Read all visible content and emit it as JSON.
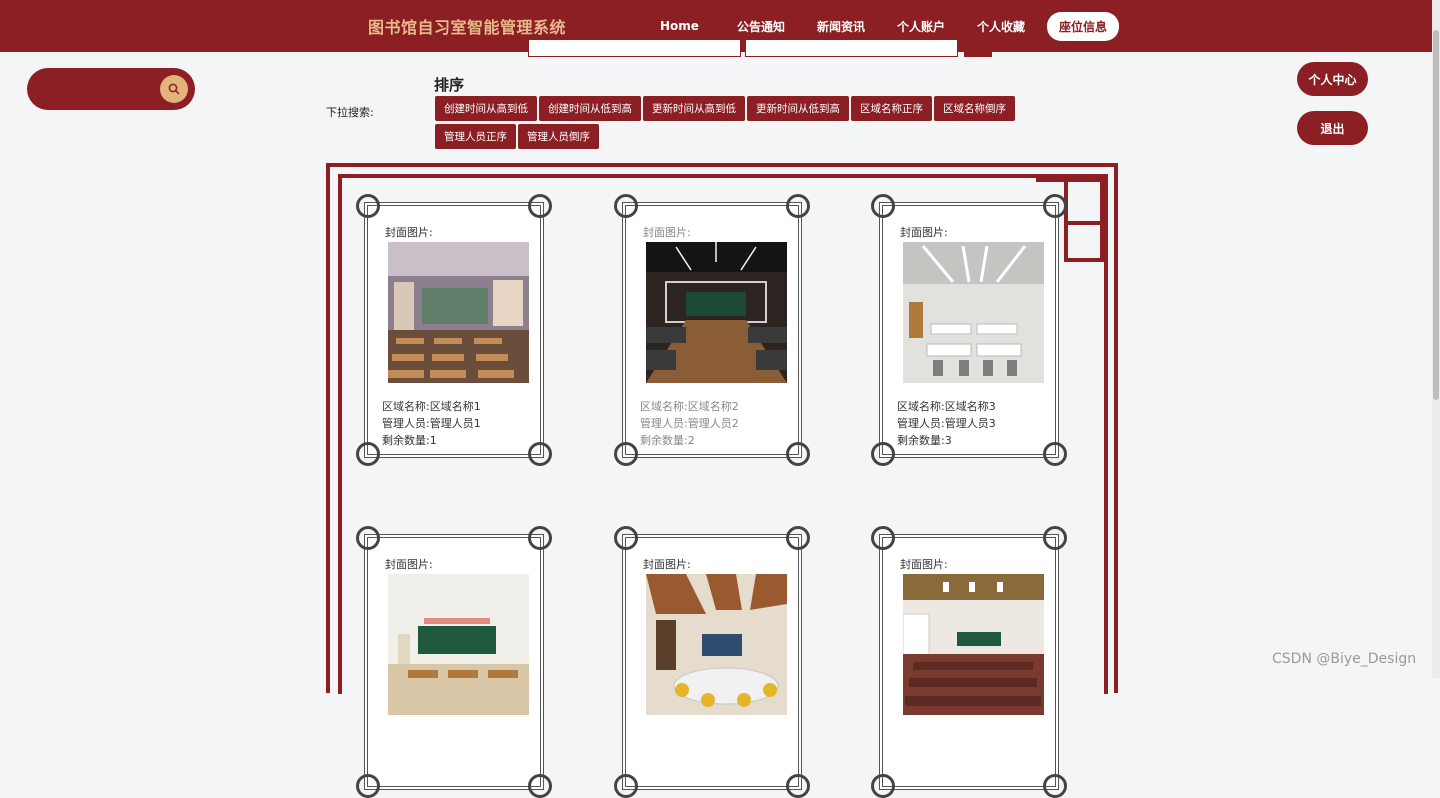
{
  "header": {
    "site_title": "图书馆自习室智能管理系统",
    "nav": [
      "Home",
      "公告通知",
      "新闻资讯",
      "个人账户",
      "个人收藏",
      "座位信息"
    ],
    "active_index": 5
  },
  "side_search": {
    "placeholder": ""
  },
  "right_actions": {
    "personal_center": "个人中心",
    "logout": "退出"
  },
  "sort": {
    "dropdown_label": "下拉搜索:",
    "title": "排序",
    "buttons": [
      "创建时间从高到低",
      "创建时间从低到高",
      "更新时间从高到低",
      "更新时间从低到高",
      "区域名称正序",
      "区域名称倒序",
      "管理人员正序",
      "管理人员倒序"
    ]
  },
  "cards": [
    {
      "cover_label": "封面图片:",
      "area": "区域名称:区域名称1",
      "manager": "管理人员:管理人员1",
      "remaining": "剩余数量:1",
      "image": "classroom-sunset"
    },
    {
      "cover_label": "封面图片:",
      "area": "区域名称:区域名称2",
      "manager": "管理人员:管理人员2",
      "remaining": "剩余数量:2",
      "image": "computer-lab"
    },
    {
      "cover_label": "封面图片:",
      "area": "区域名称:区域名称3",
      "manager": "管理人员:管理人员3",
      "remaining": "剩余数量:3",
      "image": "bright-classroom"
    },
    {
      "cover_label": "封面图片:",
      "area": "",
      "manager": "",
      "remaining": "",
      "image": "classroom-green-board"
    },
    {
      "cover_label": "封面图片:",
      "area": "",
      "manager": "",
      "remaining": "",
      "image": "wood-ceiling-room"
    },
    {
      "cover_label": "封面图片:",
      "area": "",
      "manager": "",
      "remaining": "",
      "image": "lecture-hall"
    }
  ],
  "watermark": "CSDN @Biye_Design",
  "colors": {
    "primary": "#8b1f24",
    "accent": "#e3b27d"
  }
}
